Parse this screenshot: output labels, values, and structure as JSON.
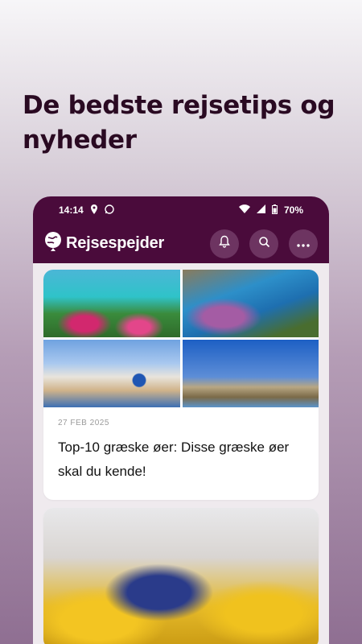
{
  "headline": "De bedste rejsetips og nyheder",
  "status_bar": {
    "time": "14:14",
    "battery": "70%",
    "icons": [
      "location-icon",
      "whatsapp-icon",
      "wifi-icon",
      "signal-icon",
      "battery-icon"
    ]
  },
  "app_bar": {
    "logo_text": "Rejsespejder",
    "actions": [
      "bell-icon",
      "search-icon",
      "more-icon"
    ]
  },
  "colors": {
    "brand": "#4a0b3b",
    "action_bg": "#6d3461",
    "headline": "#2a0a22"
  },
  "feed": [
    {
      "date": "27 FEB 2025",
      "title": "Top-10 græske øer: Disse græske øer skal du kende!",
      "images": [
        "beach-photo",
        "cliff-lagoon-photo",
        "santorini-photo",
        "coastline-photo"
      ]
    },
    {
      "images": [
        "airplane-cabin-photo"
      ]
    }
  ]
}
